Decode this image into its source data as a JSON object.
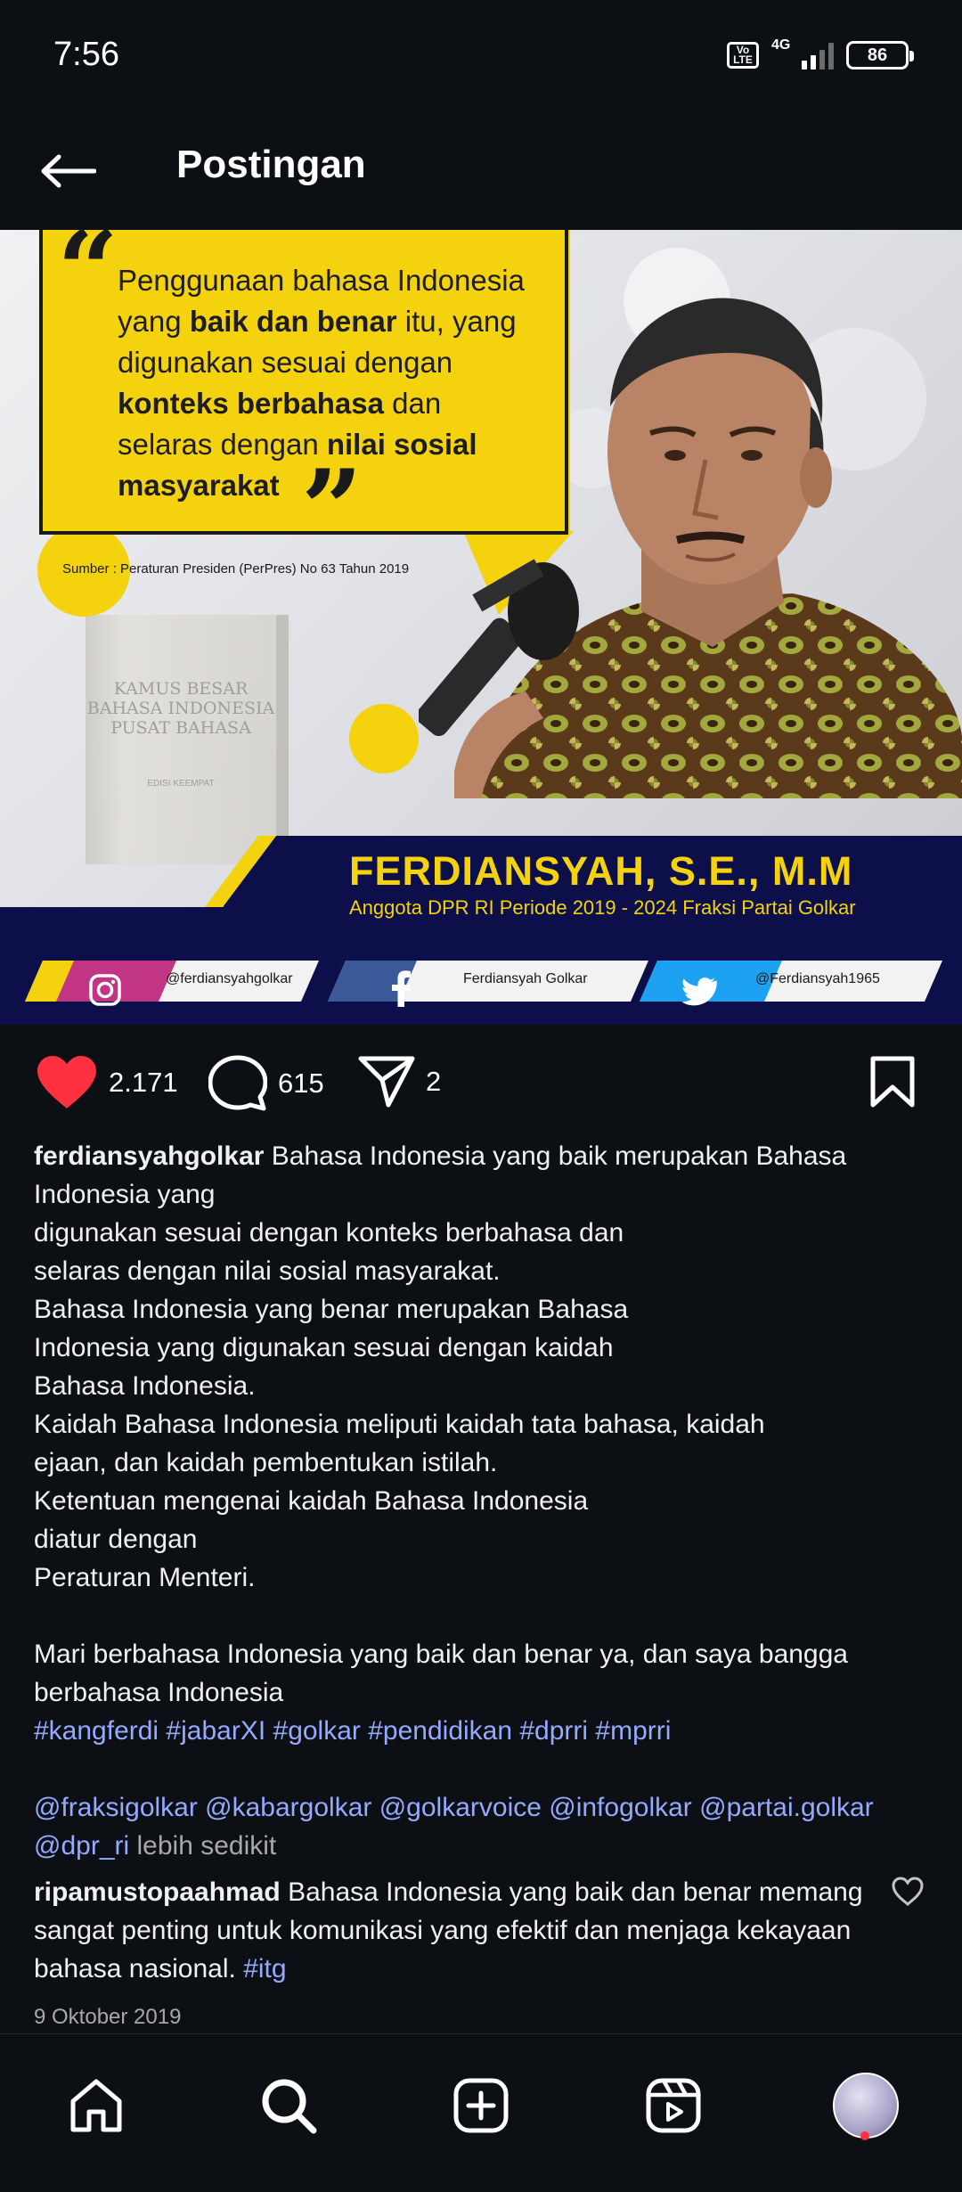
{
  "status_bar": {
    "time": "7:56",
    "volte": "Vo LTE",
    "network": "4G",
    "battery": "86"
  },
  "header": {
    "title": "Postingan"
  },
  "post_image": {
    "quote_open": "“",
    "quote_close": "”",
    "quote_lines": [
      {
        "pre": "Penggunaan bahasa Indonesia",
        "bold": "",
        "post": ""
      },
      {
        "pre": "yang ",
        "bold": "baik dan benar",
        "post": " itu, yang"
      },
      {
        "pre": "digunakan sesuai dengan",
        "bold": "",
        "post": ""
      },
      {
        "pre": "",
        "bold": "konteks berbahasa",
        "post": " dan"
      },
      {
        "pre": "selaras dengan ",
        "bold": "nilai sosial",
        "post": ""
      },
      {
        "pre": "",
        "bold": "masyarakat",
        "post": ""
      }
    ],
    "source": "Sumber : Peraturan Presiden (PerPres) No 63 Tahun 2019",
    "book_title": "KAMUS BESAR BAHASA INDONESIA PUSAT BAHASA",
    "book_subtitle": "EDISI KEEMPAT",
    "name": "FERDIANSYAH, S.E., M.M",
    "role": "Anggota DPR RI Periode 2019 - 2024 Fraksi Partai Golkar",
    "social": {
      "instagram": "@ferdiansyahgolkar",
      "facebook": "Ferdiansyah Golkar",
      "twitter": "@Ferdiansyah1965"
    }
  },
  "actions": {
    "likes": "2.171",
    "comments": "615",
    "shares": "2"
  },
  "caption": {
    "username": "ferdiansyahgolkar",
    "lines": [
      "Bahasa Indonesia yang baik merupakan Bahasa Indonesia yang",
      "digunakan sesuai dengan konteks berbahasa dan",
      "selaras dengan nilai sosial masyarakat.",
      "Bahasa Indonesia yang benar merupakan Bahasa",
      "Indonesia yang digunakan sesuai dengan kaidah",
      "Bahasa Indonesia.",
      "Kaidah Bahasa Indonesia meliputi kaidah tata bahasa, kaidah",
      "ejaan, dan kaidah pembentukan istilah.",
      "Ketentuan mengenai kaidah Bahasa Indonesia",
      "diatur dengan",
      "Peraturan Menteri."
    ],
    "paragraph2": "Mari berbahasa Indonesia yang baik dan benar ya, dan saya bangga berbahasa Indonesia",
    "hashtags": "#kangferdi #jabarXI #golkar #pendidikan #dprri #mprri",
    "mentions_line1": "@fraksigolkar @kabargolkar @golkarvoice @infogolkar @partai.golkar",
    "mentions_line2": "@dpr_ri",
    "more": "lebih sedikit"
  },
  "comment": {
    "username": "ripamustopaahmad",
    "text": "Bahasa Indonesia yang baik dan benar memang sangat penting untuk komunikasi yang efektif dan menjaga kekayaan bahasa nasional.",
    "tag": "#itg"
  },
  "post_date": "9 Oktober 2019",
  "icons": {
    "back": "arrow-left-icon",
    "like": "heart-icon",
    "comment": "comment-bubble-icon",
    "share": "paper-plane-icon",
    "save": "bookmark-icon",
    "nav": [
      "home-icon",
      "search-icon",
      "create-icon",
      "reels-icon",
      "profile-avatar"
    ]
  },
  "colors": {
    "background": "#0c1014",
    "like_red": "#ff3040",
    "link_blue": "#95a9ff",
    "golkar_yellow": "#f4d20e",
    "band_navy": "#0d0f4a"
  }
}
